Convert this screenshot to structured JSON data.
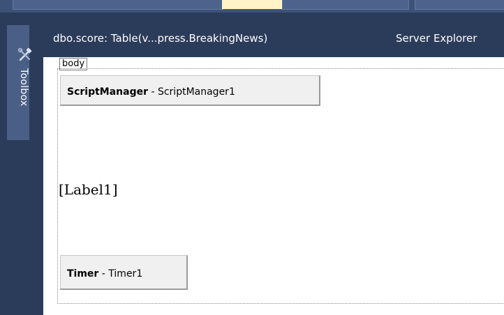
{
  "toolbox": {
    "label": "Toolbox",
    "icon": "toolbox-icon"
  },
  "document_tabs": {
    "active": "dbo.score: Table(v...press.BreakingNews)",
    "server_explorer": "Server Explorer"
  },
  "designer": {
    "body_tag": "body",
    "script_manager": {
      "type": "ScriptManager",
      "separator": " - ",
      "id": "ScriptManager1"
    },
    "label": "[Label1]",
    "timer": {
      "type": "Timer",
      "separator": " - ",
      "id": "Timer1"
    }
  },
  "colors": {
    "chrome_background": "#2b3c5a",
    "design_surface": "#ffffff",
    "control_background": "#f0f0f0"
  }
}
